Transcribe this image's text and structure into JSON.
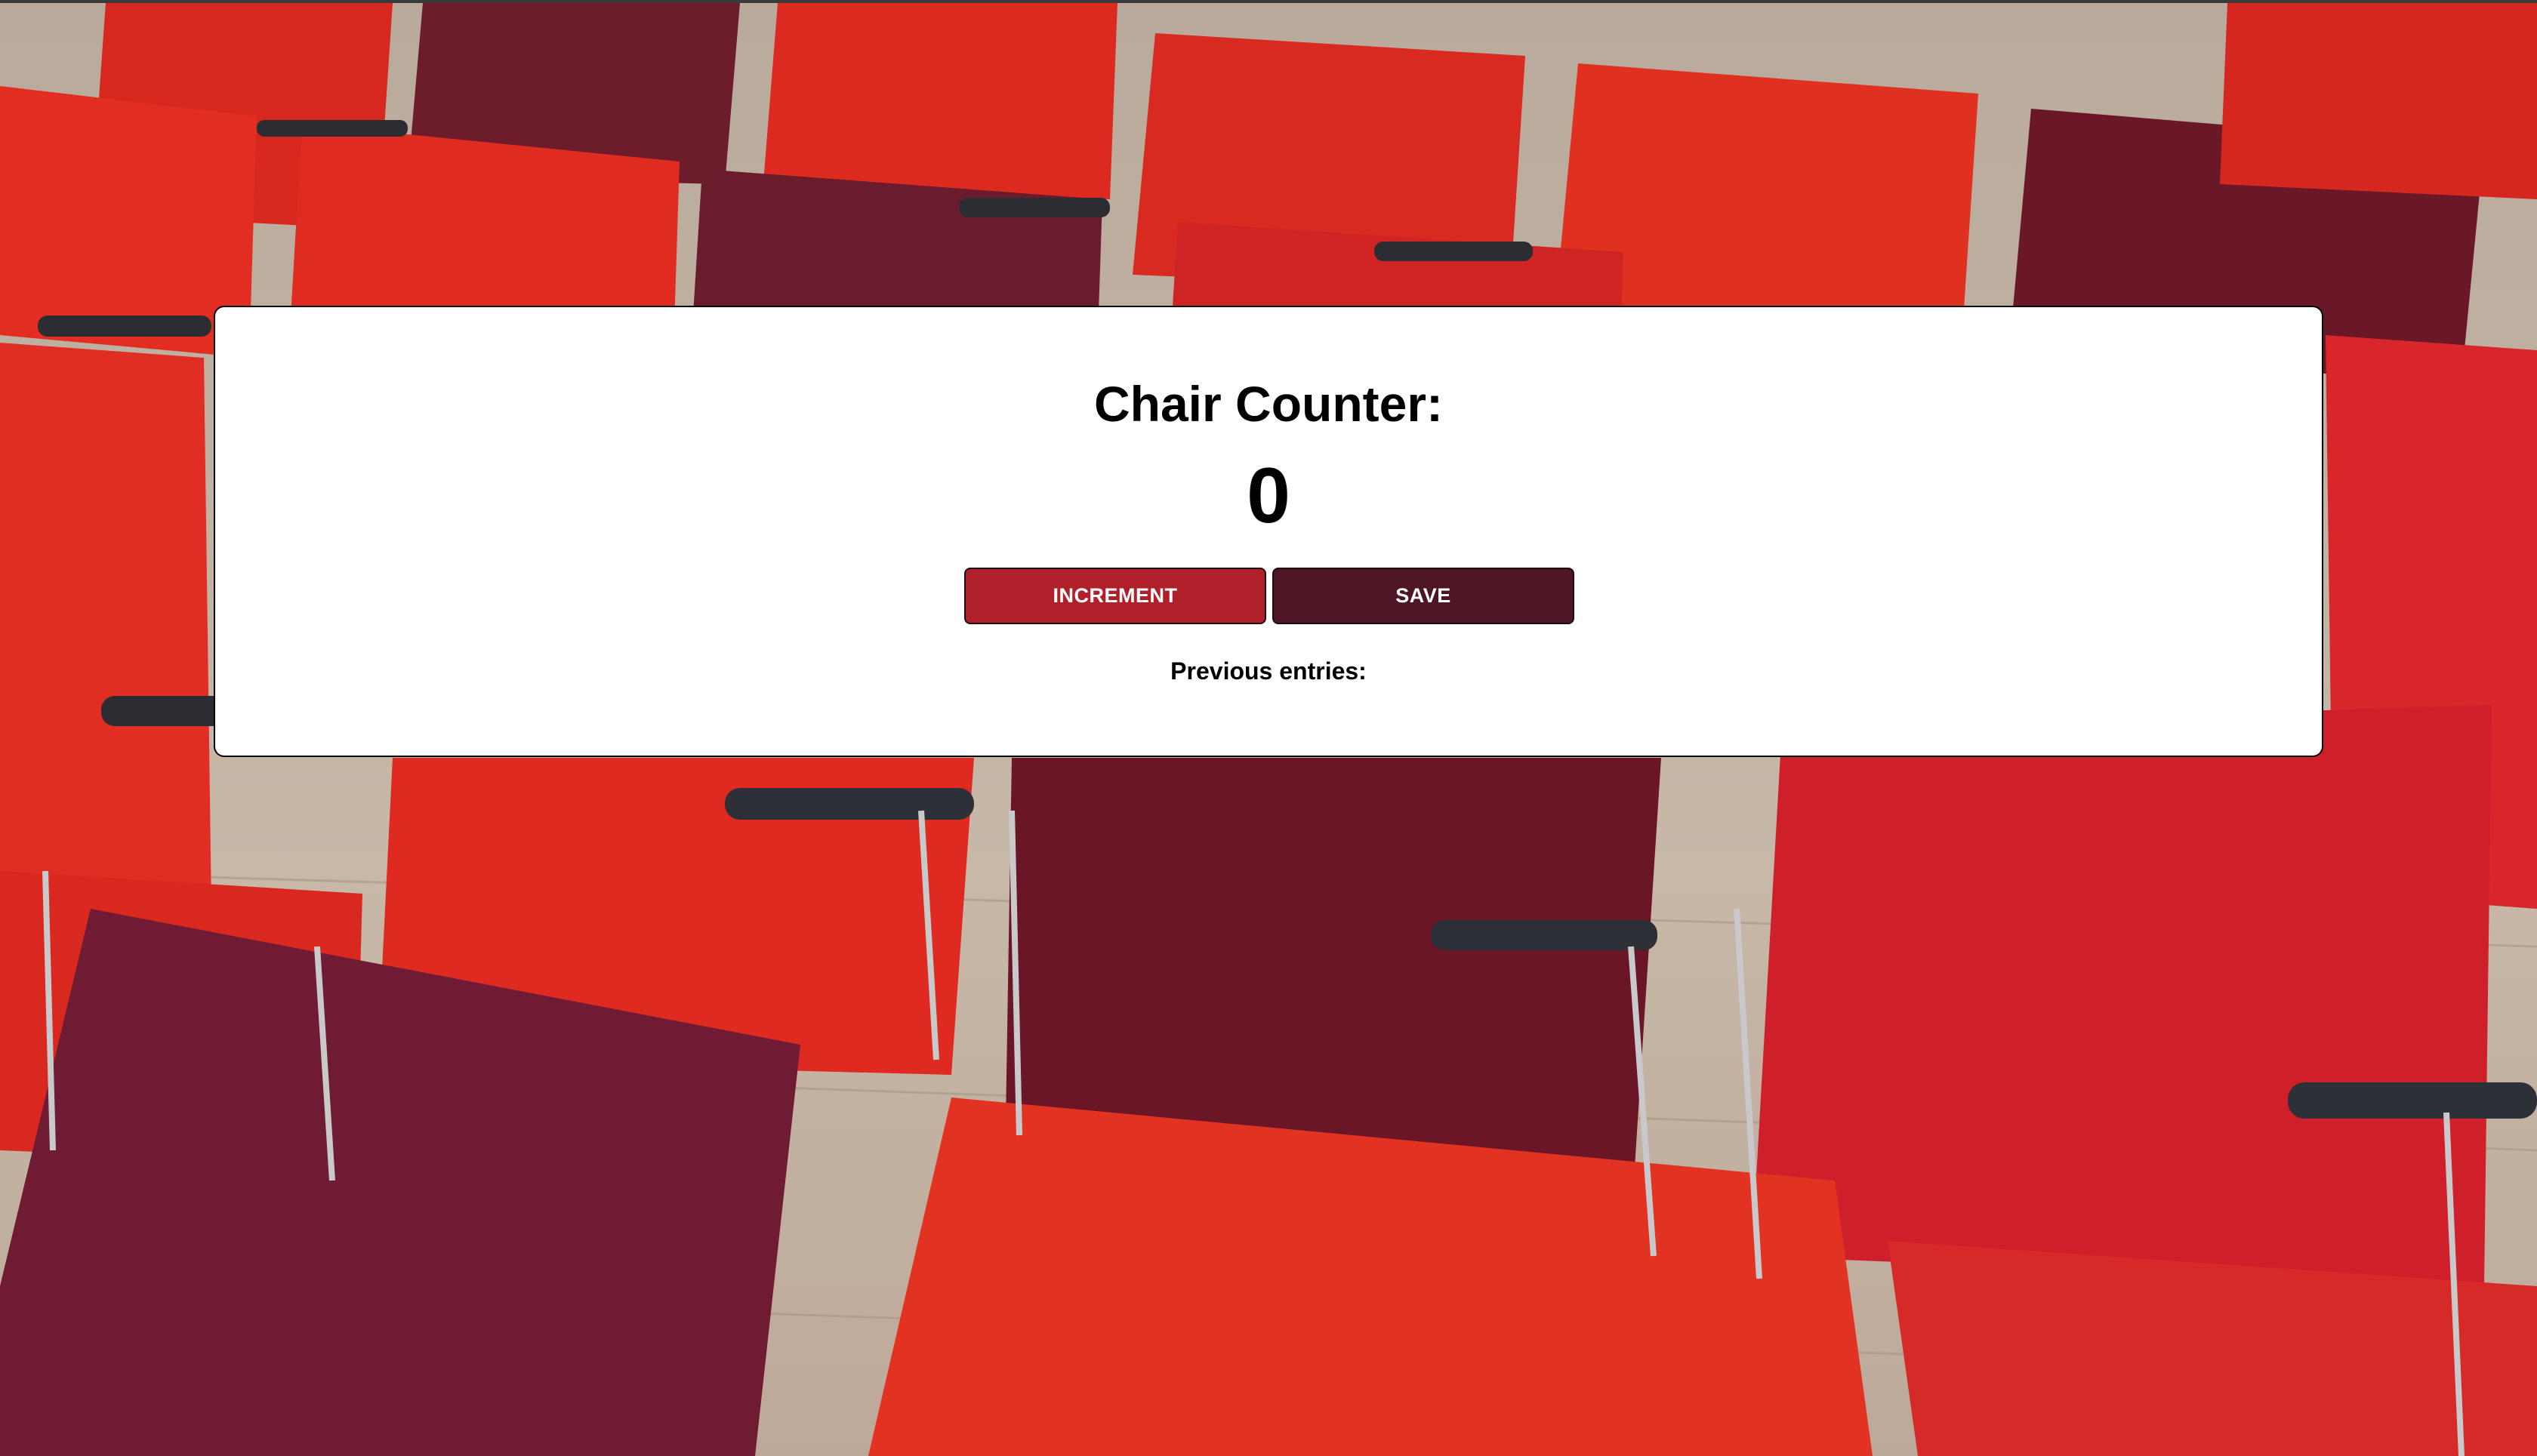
{
  "counter": {
    "title": "Chair Counter:",
    "value": "0",
    "increment_label": "INCREMENT",
    "save_label": "SAVE",
    "previous_label": "Previous entries:"
  },
  "colors": {
    "increment_button": "#b0202b",
    "save_button": "#4e1525",
    "card_background": "#ffffff"
  },
  "background": {
    "description_icon": "photo-background"
  }
}
